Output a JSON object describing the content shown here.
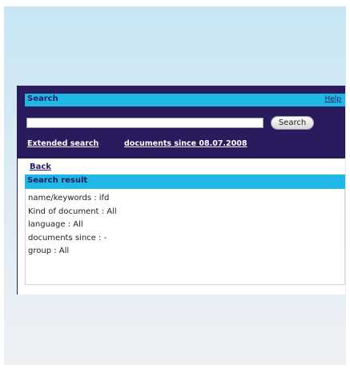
{
  "header": {
    "title": "Search",
    "help_label": "Help",
    "search_button_label": "Search",
    "search_value": "",
    "extended_search_label": "Extended search",
    "documents_since_label": "documents since 08.07.2008"
  },
  "back_label": "Back",
  "result": {
    "title": "Search result",
    "criteria": [
      "name/keywords : ifd",
      "Kind of document : All",
      "language : All",
      "documents since : -",
      "group : All"
    ]
  },
  "colors": {
    "header_bg": "#2a1a5e",
    "accent_bar": "#1fb8e6",
    "background_top": "#c7e6f4",
    "background_bottom": "#eef1f4"
  }
}
